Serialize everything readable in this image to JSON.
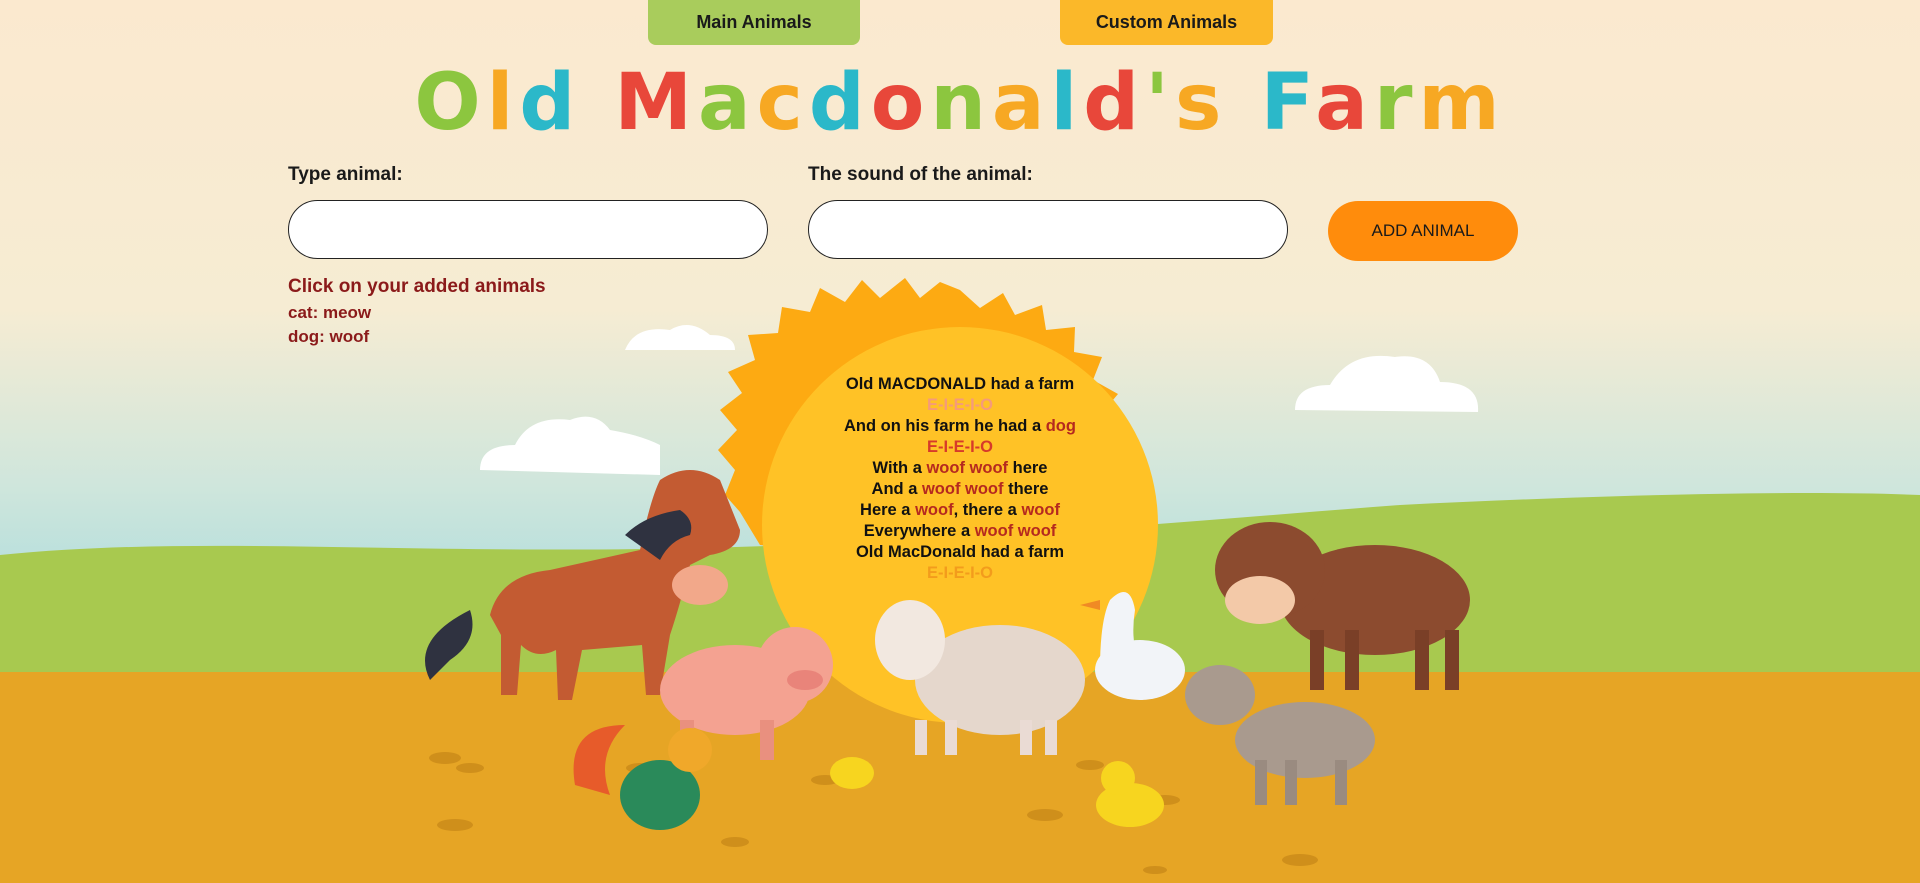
{
  "nav": {
    "main_label": "Main Animals",
    "custom_label": "Custom Animals"
  },
  "title": {
    "text": "Old Macdonald's Farm",
    "letter_colors": [
      "#8cc63f",
      "#f7a823",
      "#2bb8c9",
      "#e8473a"
    ]
  },
  "form": {
    "animal_label": "Type animal:",
    "animal_value": "",
    "sound_label": "The sound of the animal:",
    "sound_value": "",
    "add_label": "ADD ANIMAL"
  },
  "added": {
    "heading": "Click on your added animals",
    "items": [
      "cat: meow",
      "dog: woof"
    ]
  },
  "song": {
    "line1": "Old MACDONALD had a farm",
    "eieio": "E-I-E-I-O",
    "line3_pre": "And on his farm he had a ",
    "animal": "dog",
    "sound": "woof",
    "line5_pre": "With a ",
    "sound_double": "woof woof",
    "line5_post": " here",
    "line6_pre": "And a ",
    "line6_post": " there",
    "line7_pre": "Here a ",
    "line7_mid": ", there a ",
    "line8_pre": "Everywhere a ",
    "line9": "Old MacDonald had a farm"
  },
  "colors": {
    "sky_top": "#fbe9cf",
    "sky_bottom": "#9fd8de",
    "grass": "#a8c94f",
    "ground": "#e6a525",
    "sun": "#ffc226",
    "sun_rays": "#fdaa12",
    "accent_dark_red": "#8b1a1a"
  }
}
